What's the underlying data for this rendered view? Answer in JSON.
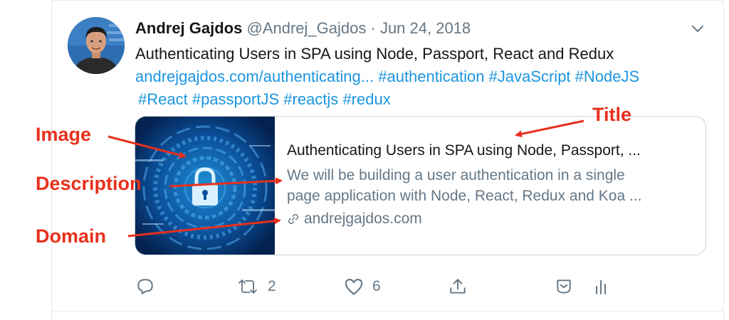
{
  "tweet": {
    "author_name": "Andrej Gajdos",
    "author_handle": "@Andrej_Gajdos",
    "separator": "·",
    "date": "Jun 24, 2018",
    "text_line1": "Authenticating Users in SPA using Node, Passport, React and Redux",
    "link_url": "andrejgajdos.com/authenticating...",
    "hashtags_line2": [
      "#authentication",
      "#JavaScript",
      "#NodeJS"
    ],
    "hashtags_line3": [
      "#React",
      "#passportJS",
      "#reactjs",
      "#redux"
    ]
  },
  "card": {
    "title": "Authenticating Users in SPA using Node, Passport, ...",
    "description_line1": "We will be building a user authentication in a single",
    "description_line2": "page application with Node, React, Redux and Koa ...",
    "domain": "andrejgajdos.com"
  },
  "annotations": {
    "title": "Title",
    "image": "Image",
    "description": "Description",
    "domain": "Domain",
    "color": "#e8301c"
  },
  "actions": {
    "reply_icon": "reply-icon",
    "retweet_count": "2",
    "like_count": "6",
    "share_icon": "share-icon",
    "bookmark_icon": "bookmark-icon",
    "analytics_icon": "analytics-icon"
  },
  "colors": {
    "link": "#1b95e0",
    "text": "#14171a",
    "muted": "#657786",
    "card_border": "#ccd6dd"
  }
}
